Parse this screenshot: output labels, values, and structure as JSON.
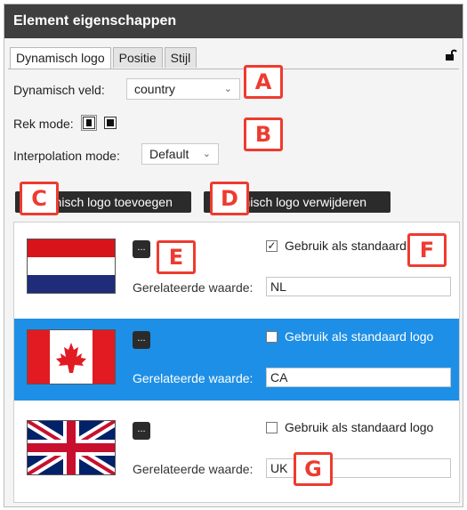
{
  "panel": {
    "title": "Element eigenschappen"
  },
  "tabs": [
    {
      "label": "Dynamisch logo",
      "active": true
    },
    {
      "label": "Positie",
      "active": false
    },
    {
      "label": "Stijl",
      "active": false
    }
  ],
  "fields": {
    "dynamic_field_label": "Dynamisch veld:",
    "dynamic_field_value": "country",
    "stretch_mode_label": "Rek mode:",
    "interpolation_label": "Interpolation mode:",
    "interpolation_value": "Default"
  },
  "buttons": {
    "add_logo": "Dynamisch logo toevoegen",
    "remove_logo": "Dynamisch logo verwijderen",
    "browse": "..."
  },
  "logos": [
    {
      "flag": "netherlands",
      "default_label": "Gebruik als standaard logo",
      "is_default": true,
      "related_label": "Gerelateerde waarde:",
      "related_value": "NL",
      "selected": false
    },
    {
      "flag": "canada",
      "default_label": "Gebruik als standaard logo",
      "is_default": false,
      "related_label": "Gerelateerde waarde:",
      "related_value": "CA",
      "selected": true
    },
    {
      "flag": "united-kingdom",
      "default_label": "Gebruik als standaard logo",
      "is_default": false,
      "related_label": "Gerelateerde waarde:",
      "related_value": "UK",
      "selected": false
    }
  ],
  "callouts": [
    "A",
    "B",
    "C",
    "D",
    "E",
    "F",
    "G"
  ],
  "colors": {
    "accent": "#ee3b2f",
    "selection": "#1e8fe6",
    "titlebar": "#3f3f3f"
  },
  "icons": {
    "lock": "unlock-icon",
    "dropdown": "chevron-down-icon",
    "check": "✓"
  }
}
